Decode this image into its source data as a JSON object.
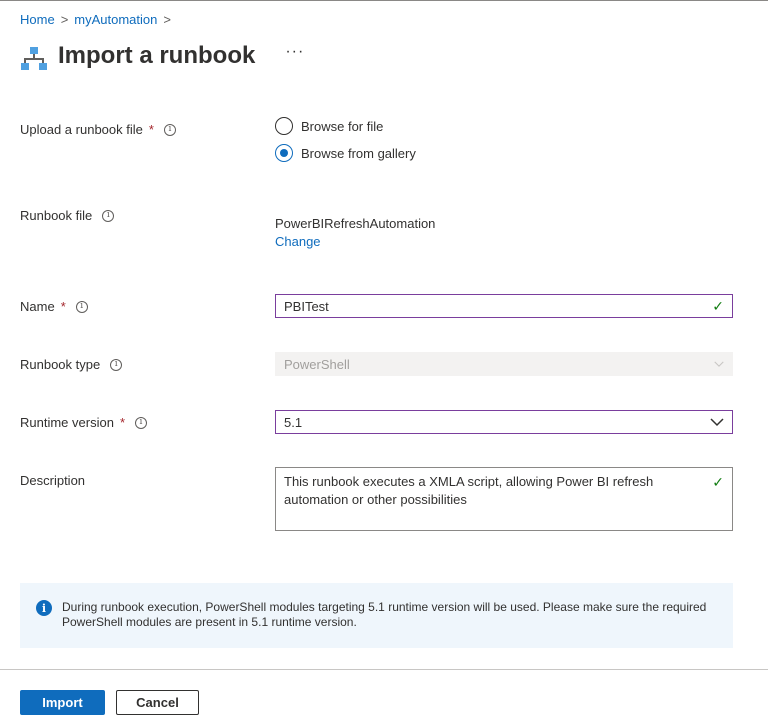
{
  "breadcrumb": {
    "home": "Home",
    "automation": "myAutomation",
    "sep": ">"
  },
  "header": {
    "title": "Import a runbook",
    "more": "···"
  },
  "upload": {
    "label": "Upload a runbook file",
    "required": "*",
    "options": [
      "Browse for file",
      "Browse from gallery"
    ],
    "selected_index": 1
  },
  "runbook_file": {
    "label": "Runbook file",
    "value": "PowerBIRefreshAutomation",
    "change_link": "Change"
  },
  "name": {
    "label": "Name",
    "required": "*",
    "value": "PBITest"
  },
  "runbook_type": {
    "label": "Runbook type",
    "value": "PowerShell"
  },
  "runtime": {
    "label": "Runtime version",
    "required": "*",
    "value": "5.1"
  },
  "description": {
    "label": "Description",
    "value": "This runbook executes a XMLA script, allowing Power BI refresh automation or other possibilities"
  },
  "banner": {
    "text": "During runbook execution, PowerShell modules targeting 5.1 runtime version will be used. Please make sure the required PowerShell modules are present in 5.1 runtime version."
  },
  "buttons": {
    "import": "Import",
    "cancel": "Cancel"
  },
  "colors": {
    "accent": "#0f6cbd",
    "valid": "#107c10",
    "required": "#a4262c",
    "banner_bg": "#eff6fc"
  }
}
